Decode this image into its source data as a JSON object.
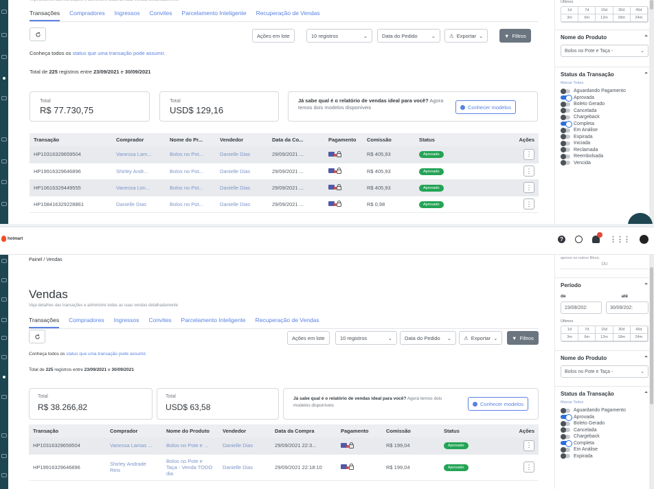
{
  "app": {
    "logo_text": "hotmart"
  },
  "breadcrumb": "Painel / Vendas",
  "page": {
    "title": "Vendas",
    "subtitle": "Veja detalhes das transações e administre todas as suas vendas detalhadamente"
  },
  "tabs": [
    "Transações",
    "Compradores",
    "Ingressos",
    "Convites",
    "Parcelamento Inteligente",
    "Recuperação de Vendas"
  ],
  "toolbar": {
    "bulk": "Ações em lote",
    "per_page": "10 registros",
    "sort": "Data do Pedido",
    "export": "Exportar",
    "filters": "Filtros"
  },
  "info": {
    "prefix": "Conheça todos os",
    "link": "status que uma transação pode assumir."
  },
  "records": {
    "before": "Total de",
    "count": "225",
    "middle": "registros entre",
    "start": "23/09/2021",
    "conj": "e",
    "end": "30/09/2021"
  },
  "promo": {
    "bold": "Já sabe qual é o relatório de vendas ideal para você?",
    "rest": "Agora temos dois modelos disponíveis",
    "button": "Conhecer modelos"
  },
  "top_panel": {
    "total_label": "Total",
    "total_brl": "R$ 77.730,75",
    "total_usd": "USD$ 129,16",
    "columns": [
      "Transação",
      "Comprador",
      "Nome do Pr...",
      "Vendedor",
      "Data da Co...",
      "Pagamento",
      "Comissão",
      "Status",
      "Ações"
    ],
    "rows": [
      {
        "id": "HP10316329659504",
        "buyer": "Vanessa Lam...",
        "product": "Bolos no Pot...",
        "seller": "Danielle Dias",
        "date": "29/09/2021 ...",
        "commission": "R$ 405,93",
        "status": "Aprovado"
      },
      {
        "id": "HP19916329646896",
        "buyer": "Shirley Andr...",
        "product": "Bolos no Pot...",
        "seller": "Danielle Dias",
        "date": "29/09/2021 ...",
        "commission": "R$ 405,93",
        "status": "Aprovado"
      },
      {
        "id": "HP10616329449555",
        "buyer": "Vanessa Lim...",
        "product": "Bolos no Pot...",
        "seller": "Danielle Dias",
        "date": "29/09/2021 ...",
        "commission": "R$ 405,93",
        "status": "Aprovado"
      },
      {
        "id": "HP108416329228861",
        "buyer": "Danielle Dias",
        "product": "Bolos no Pot...",
        "seller": "Danielle Dias",
        "date": "29/09/2021 ...",
        "commission": "R$ 0,98",
        "status": "Aprovado"
      }
    ]
  },
  "bottom_panel": {
    "total_label": "Total",
    "total_brl": "R$ 38.266,82",
    "total_usd": "USD$ 63,58",
    "columns": [
      "Transação",
      "Comprador",
      "Nome do Produto",
      "Vendedor",
      "Data da Compra",
      "Pagamento",
      "Comissão",
      "Status",
      "Ações"
    ],
    "rows": [
      {
        "id": "HP10316329659504",
        "buyer": "Vanessa Lamas ...",
        "product": "Bolos no Pote e ...",
        "seller": "Danielle Dias",
        "date": "29/09/2021 22:3...",
        "commission": "R$ 199,04",
        "status": "Aprovado"
      },
      {
        "id": "HP19916329646896",
        "buyer": "Shirley Andrade Reis",
        "product": "Bolos no Pote e Taça - Venda TODO dia",
        "seller": "Danielle Dias",
        "date": "29/09/2021 22:18:10",
        "commission": "R$ 199,04",
        "status": "Aprovado"
      }
    ]
  },
  "filters": {
    "top_heading": "Últimos",
    "or_note": "aprove os outros filtros.",
    "or": "OU",
    "period_title": "Período",
    "from_label": "de",
    "to_label": "até",
    "from": "23/09/202:",
    "to": "30/09/202:",
    "last_label": "Últimos",
    "ranges": [
      "1d",
      "7d",
      "15d",
      "30d",
      "45d",
      "3m",
      "6m",
      "12m",
      "18m",
      "24m"
    ],
    "product_title": "Nome do Produto",
    "product": "Bolos no Pote e Taça -",
    "status_title": "Status da Transação",
    "mark_all": "Marcar Todos",
    "statuses": [
      {
        "label": "Aguardando Pagamento",
        "on": false
      },
      {
        "label": "Aprovada",
        "on": true
      },
      {
        "label": "Boleto Gerado",
        "on": false
      },
      {
        "label": "Cancelada",
        "on": false
      },
      {
        "label": "Chargeback",
        "on": false
      },
      {
        "label": "Completa",
        "on": true
      },
      {
        "label": "Em Análise",
        "on": false
      },
      {
        "label": "Expirada",
        "on": false
      },
      {
        "label": "Iniciada",
        "on": false
      },
      {
        "label": "Reclamada",
        "on": false
      },
      {
        "label": "Reembolsada",
        "on": false
      },
      {
        "label": "Vencida",
        "on": false
      }
    ]
  },
  "colors": {
    "brand": "#f04e23",
    "accent": "#5981e3",
    "sidebar": "#1e4650",
    "success": "#23a455"
  },
  "icons": [
    "refresh-icon",
    "warning-icon",
    "filter-icon",
    "info-icon",
    "help-icon",
    "smile-icon",
    "notification-icon",
    "apps-grid-icon",
    "avatar"
  ]
}
